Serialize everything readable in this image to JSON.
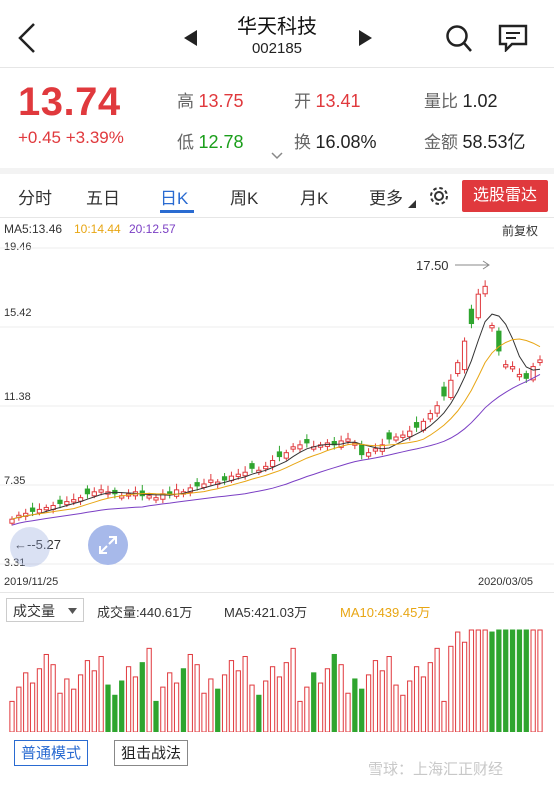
{
  "header": {
    "name": "华天科技",
    "code": "002185"
  },
  "quote": {
    "price": "13.74",
    "change": "+0.45",
    "change_pct": "+3.39%",
    "high_label": "高",
    "high": "13.75",
    "low_label": "低",
    "low": "12.78",
    "open_label": "开",
    "open": "13.41",
    "turnover_label": "换",
    "turnover": "16.08%",
    "volume_ratio_label": "量比",
    "volume_ratio": "1.02",
    "amount_label": "金额",
    "amount": "58.53亿"
  },
  "tabs": [
    "分时",
    "五日",
    "日K",
    "周K",
    "月K",
    "更多"
  ],
  "active_tab": "日K",
  "radar_button": "选股雷达",
  "ma": {
    "ma5": "MA5:13.46",
    "ma10": "10:14.44",
    "ma20": "20:12.57",
    "adjust": "前复权"
  },
  "chart_data": {
    "type": "candlestick",
    "date_start": "2019/11/25",
    "date_end": "2020/03/05",
    "y_ticks": [
      "19.46",
      "15.42",
      "11.38",
      "7.35",
      "3.31"
    ],
    "ylim": [
      3.31,
      19.46
    ],
    "max_label": "17.50",
    "min_label": "5.27",
    "closes": [
      5.6,
      5.8,
      5.9,
      6.0,
      6.1,
      6.2,
      6.3,
      6.4,
      6.5,
      6.6,
      6.7,
      6.9,
      7.0,
      7.1,
      7.0,
      6.9,
      6.8,
      6.9,
      7.0,
      6.8,
      6.8,
      6.7,
      6.9,
      6.9,
      7.1,
      7.0,
      7.2,
      7.3,
      7.4,
      7.6,
      7.5,
      7.6,
      7.8,
      7.9,
      8.0,
      8.2,
      8.1,
      8.3,
      8.6,
      8.8,
      9.0,
      9.3,
      9.4,
      9.5,
      9.3,
      9.4,
      9.5,
      9.4,
      9.6,
      9.7,
      9.5,
      8.9,
      9.0,
      9.2,
      9.4,
      9.7,
      9.8,
      9.9,
      10.1,
      10.3,
      10.6,
      11.0,
      11.4,
      11.9,
      12.7,
      13.6,
      14.7,
      15.6,
      17.1,
      17.5,
      15.5,
      14.2,
      13.5,
      13.4,
      13.0,
      12.8,
      13.4,
      13.74
    ],
    "volume": {
      "label": "成交量",
      "value": "成交量:440.61万",
      "ma5": "MA5:421.03万",
      "ma10": "MA10:439.45万"
    }
  },
  "bottom": {
    "mode_normal": "普通模式",
    "mode_sniper": "狙击战法"
  },
  "colors": {
    "up": "#e0393d",
    "down": "#2fa52f",
    "accent": "#2a6bd1"
  },
  "watermark": "雪球：上海汇正财经"
}
